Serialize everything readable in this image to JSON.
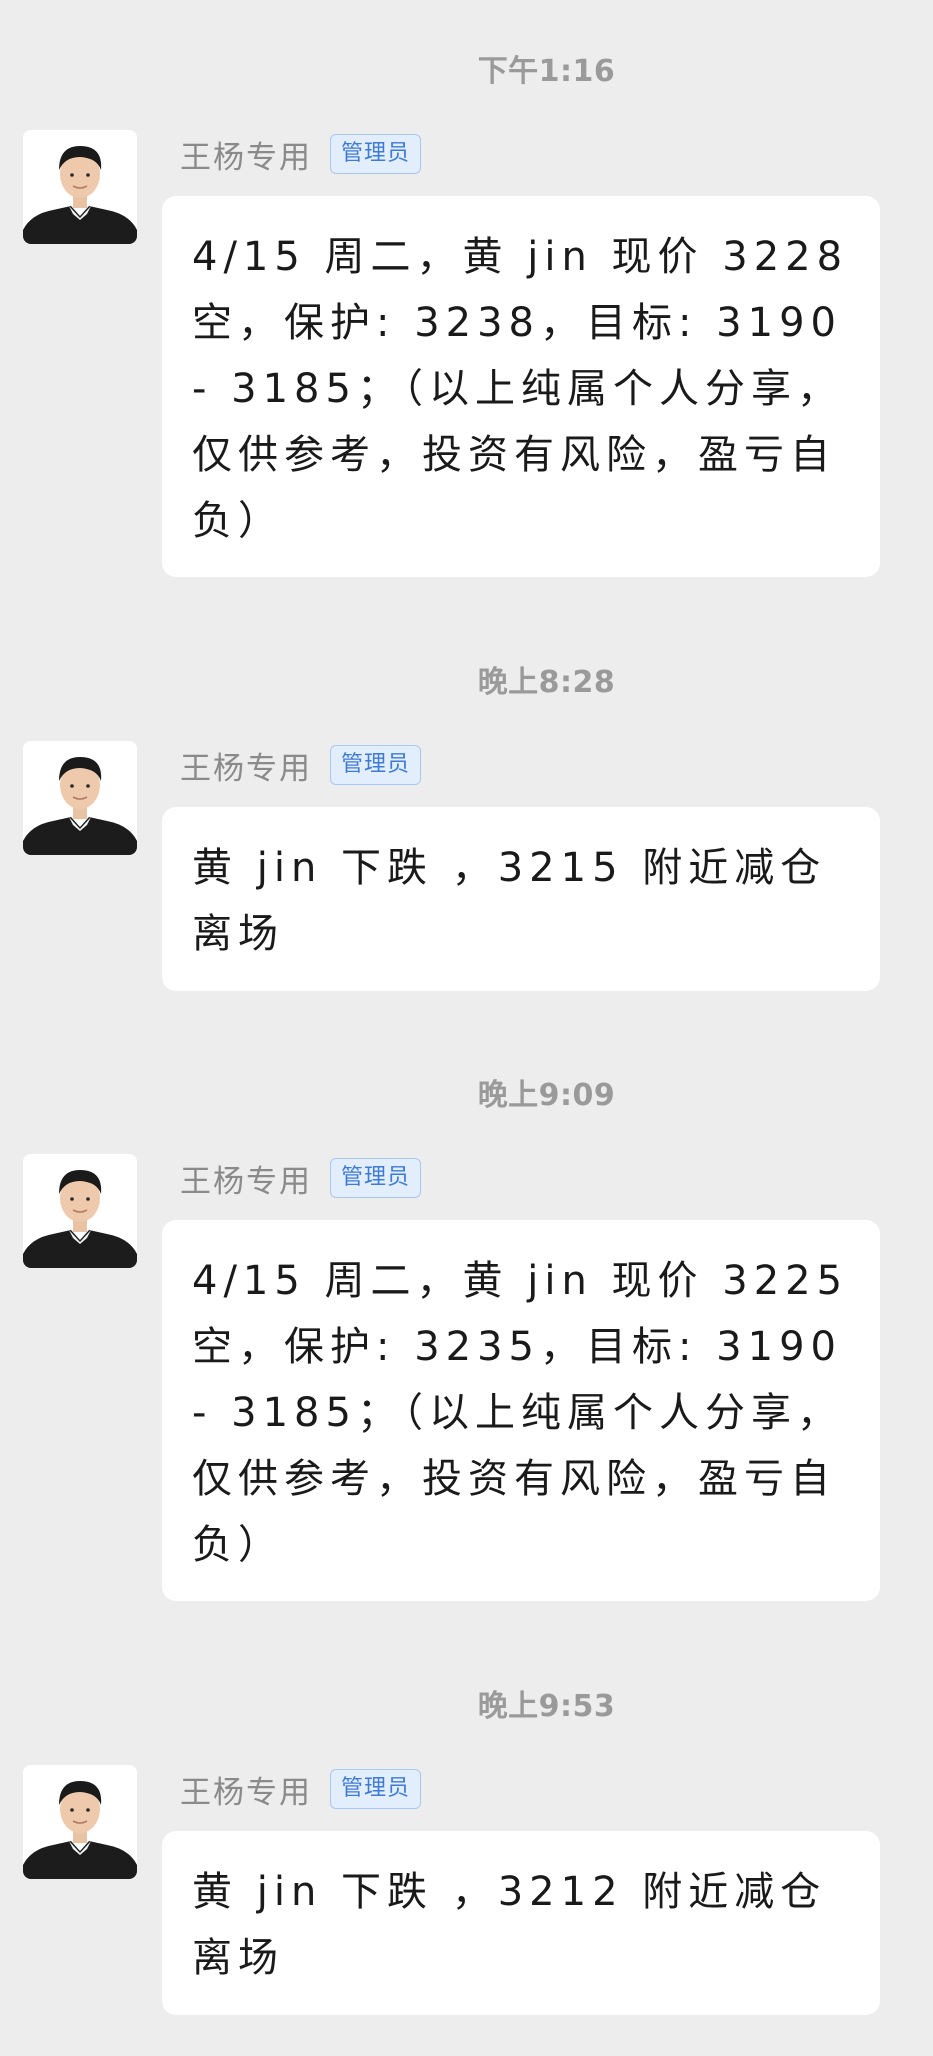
{
  "colors": {
    "background": "#EDEDED",
    "bubble": "#FFFFFF",
    "timestamp": "#9A9A9A",
    "sender_name": "#8A8A8A",
    "badge_text": "#3E7BD4",
    "badge_bg": "#E3EEFC"
  },
  "messages": [
    {
      "timestamp": "下午1:16",
      "sender": "王杨专用",
      "badge": "管理员",
      "avatar_icon": "person-avatar-icon",
      "text": "4/15 周二，黄 jin 现价 3228 空，保护: 3238，目标: 3190 - 3185；（以上纯属个人分享，仅供参考，投资有风险，盈亏自负）"
    },
    {
      "timestamp": "晚上8:28",
      "sender": "王杨专用",
      "badge": "管理员",
      "avatar_icon": "person-avatar-icon",
      "text": "黄 jin 下跌 ，3215 附近减仓离场"
    },
    {
      "timestamp": "晚上9:09",
      "sender": "王杨专用",
      "badge": "管理员",
      "avatar_icon": "person-avatar-icon",
      "text": "4/15 周二，黄 jin 现价 3225 空，保护: 3235，目标: 3190 - 3185；（以上纯属个人分享，仅供参考，投资有风险，盈亏自负）"
    },
    {
      "timestamp": "晚上9:53",
      "sender": "王杨专用",
      "badge": "管理员",
      "avatar_icon": "person-avatar-icon",
      "text": "黄 jin 下跌 ，3212 附近减仓离场"
    }
  ]
}
